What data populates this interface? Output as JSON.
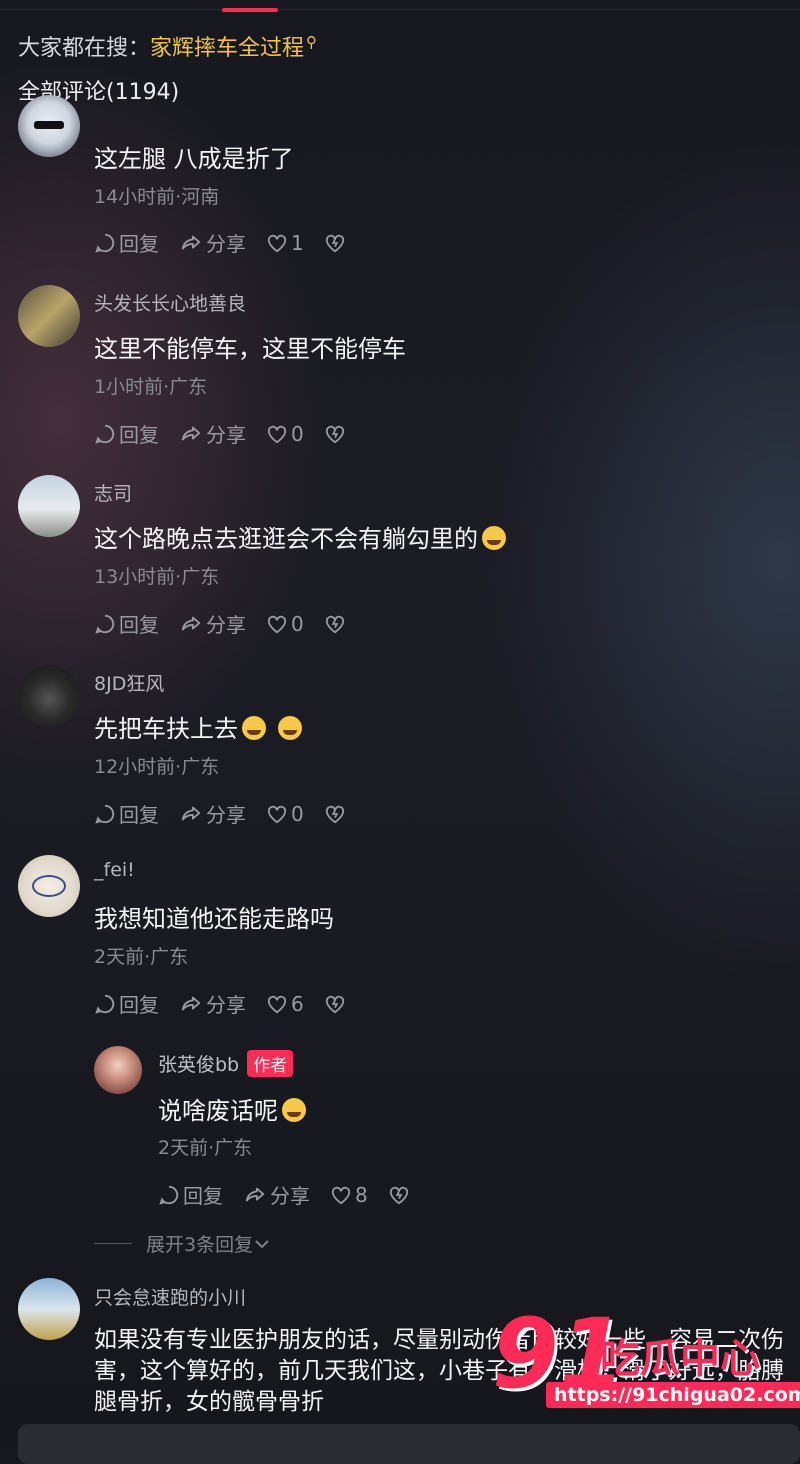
{
  "header": {
    "search_prefix": "大家都在搜：",
    "search_term": "家辉摔车全过程",
    "comments_total_label": "全部评论(1194)"
  },
  "actions_labels": {
    "reply": "回复",
    "share": "分享"
  },
  "comments": [
    {
      "username": "",
      "text": "这左腿 八成是折了",
      "meta": "14小时前·河南",
      "likes": "1"
    },
    {
      "username": "头发长长心地善良",
      "text": "这里不能停车，这里不能停车",
      "meta": "1小时前·广东",
      "likes": "0"
    },
    {
      "username": "志司",
      "text": "这个路晚点去逛逛会不会有躺勾里的",
      "meta": "13小时前·广东",
      "likes": "0"
    },
    {
      "username": "8JD狂风",
      "text": "先把车扶上去",
      "meta": "12小时前·广东",
      "likes": "0"
    },
    {
      "username": "_fei!",
      "text": "我想知道他还能走路吗",
      "meta": "2天前·广东",
      "likes": "6"
    }
  ],
  "reply": {
    "username": "张英俊bb",
    "badge": "作者",
    "text": "说啥废话呢",
    "meta": "2天前·广东",
    "likes": "8"
  },
  "expand_label": "展开3条回复",
  "last_comment": {
    "username": "只会怠速跑的小川",
    "text": "如果没有专业医护朋友的话，尽量别动伤者比较好一些，容易二次伤害，这个算好的，前几天我们这，小巷子有个滑板，滑了好远，胳膊腿骨折，女的髋骨骨折"
  },
  "watermark": {
    "number": "91",
    "brand": "吃瓜中心",
    "url": "https://91chigua02.com"
  },
  "colors": {
    "accent": "#fe2c55",
    "search_term": "#f2c443",
    "background": "#1a1b22"
  }
}
